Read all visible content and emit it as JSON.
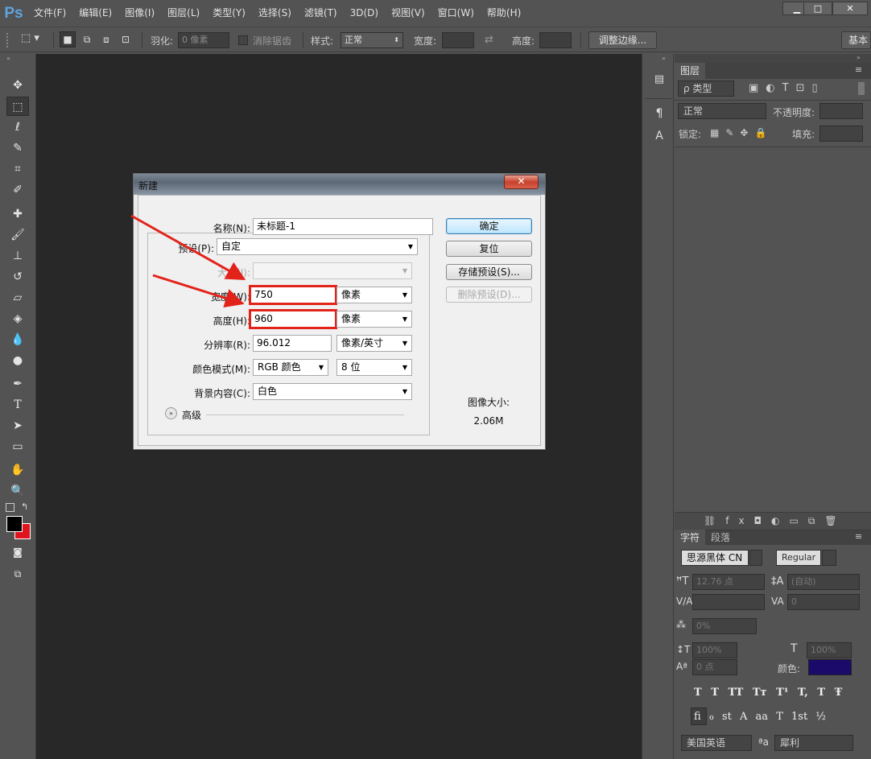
{
  "app": {
    "logo": "Ps"
  },
  "menu": [
    "文件(F)",
    "编辑(E)",
    "图像(I)",
    "图层(L)",
    "类型(Y)",
    "选择(S)",
    "滤镜(T)",
    "3D(D)",
    "视图(V)",
    "窗口(W)",
    "帮助(H)"
  ],
  "window_controls": {
    "minimize": "▁",
    "maximize": "□",
    "close": "✕"
  },
  "options_bar": {
    "feather_label": "羽化:",
    "feather_value": "0 像素",
    "antialias_label": "消除锯齿",
    "style_label": "样式:",
    "style_value": "正常",
    "width_label": "宽度:",
    "height_label": "高度:",
    "refine_edge": "调整边缘...",
    "workspace": "基本"
  },
  "layers_panel": {
    "tab": "图层",
    "filter_kind": "ρ 类型",
    "blend_mode": "正常",
    "opacity_label": "不透明度:",
    "lock_label": "锁定:",
    "fill_label": "填充:"
  },
  "character_panel": {
    "tabs": [
      "字符",
      "段落"
    ],
    "font_family": "思源黑体 CN",
    "font_style": "Regular",
    "font_size": "12.76 点",
    "leading": "(自动)",
    "tracking": "0",
    "scale": "0%",
    "vertical_scale": "100%",
    "horizontal_scale": "100%",
    "baseline": "0 点",
    "color_label": "颜色:",
    "color": "#1c0a6b",
    "language": "美国英语",
    "antialias": "犀利",
    "style_buttons": [
      "T",
      "T",
      "TT",
      "Tт",
      "T¹",
      "T,",
      "T",
      "Ŧ"
    ],
    "ot_buttons": [
      "fi",
      "ℴ",
      "st",
      "A",
      "aa",
      "T",
      "1st",
      "½"
    ]
  },
  "dialog": {
    "title": "新建",
    "close": "✕",
    "name_label": "名称(N):",
    "name_value": "未标题-1",
    "preset_label": "预设(P):",
    "preset_value": "自定",
    "size_label": "大小(I):",
    "width_label": "宽度(W):",
    "width_value": "750",
    "width_unit": "像素",
    "height_label": "高度(H):",
    "height_value": "960",
    "height_unit": "像素",
    "resolution_label": "分辨率(R):",
    "resolution_value": "96.012",
    "resolution_unit": "像素/英寸",
    "color_mode_label": "颜色模式(M):",
    "color_mode_value": "RGB 颜色",
    "bit_depth": "8 位",
    "background_label": "背景内容(C):",
    "background_value": "白色",
    "advanced_label": "高级",
    "ok": "确定",
    "reset": "复位",
    "save_preset": "存储预设(S)...",
    "delete_preset": "删除预设(D)...",
    "image_size_label": "图像大小:",
    "image_size_value": "2.06M"
  },
  "colors": {
    "foreground": "#000000",
    "background": "#e0141e",
    "highlight": "#e2231a"
  }
}
